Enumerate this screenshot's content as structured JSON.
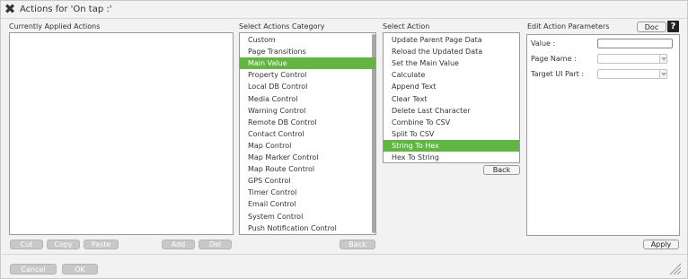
{
  "dialog": {
    "title": "Actions for 'On tap :'"
  },
  "applied": {
    "label": "Currently Applied Actions",
    "buttons": {
      "cut": "Cut",
      "copy": "Copy",
      "paste": "Paste",
      "add": "Add",
      "del": "Del"
    }
  },
  "categories": {
    "label": "Select Actions Category",
    "selected": "Main Value",
    "items": [
      "Custom",
      "Page Transitions",
      "Main Value",
      "Property Control",
      "Local DB Control",
      "Media Control",
      "Warning Control",
      "Remote DB Control",
      "Contact Control",
      "Map Control",
      "Map Marker Control",
      "Map Route Control",
      "GPS Control",
      "Timer Control",
      "Email Control",
      "System Control",
      "Push Notification Control"
    ],
    "back": "Back"
  },
  "actions": {
    "label": "Select Action",
    "selected": "String To Hex",
    "items": [
      "Update Parent Page Data",
      "Reload the Updated Data",
      "Set the Main Value",
      "Calculate",
      "Append Text",
      "Clear Text",
      "Delete Last Character",
      "Combine To CSV",
      "Split To CSV",
      "String To Hex",
      "Hex To String"
    ],
    "back": "Back"
  },
  "params": {
    "label": "Edit Action Parameters",
    "doc": "Doc",
    "help_icon": "?",
    "fields": {
      "value": "Value :",
      "page_name": "Page Name :",
      "target_ui": "Target UI Part :"
    },
    "value_input": "",
    "apply": "Apply"
  },
  "footer": {
    "cancel": "Cancel",
    "ok": "OK"
  },
  "colors": {
    "selection": "#62b543",
    "panel_bg": "#f2f2f2"
  }
}
